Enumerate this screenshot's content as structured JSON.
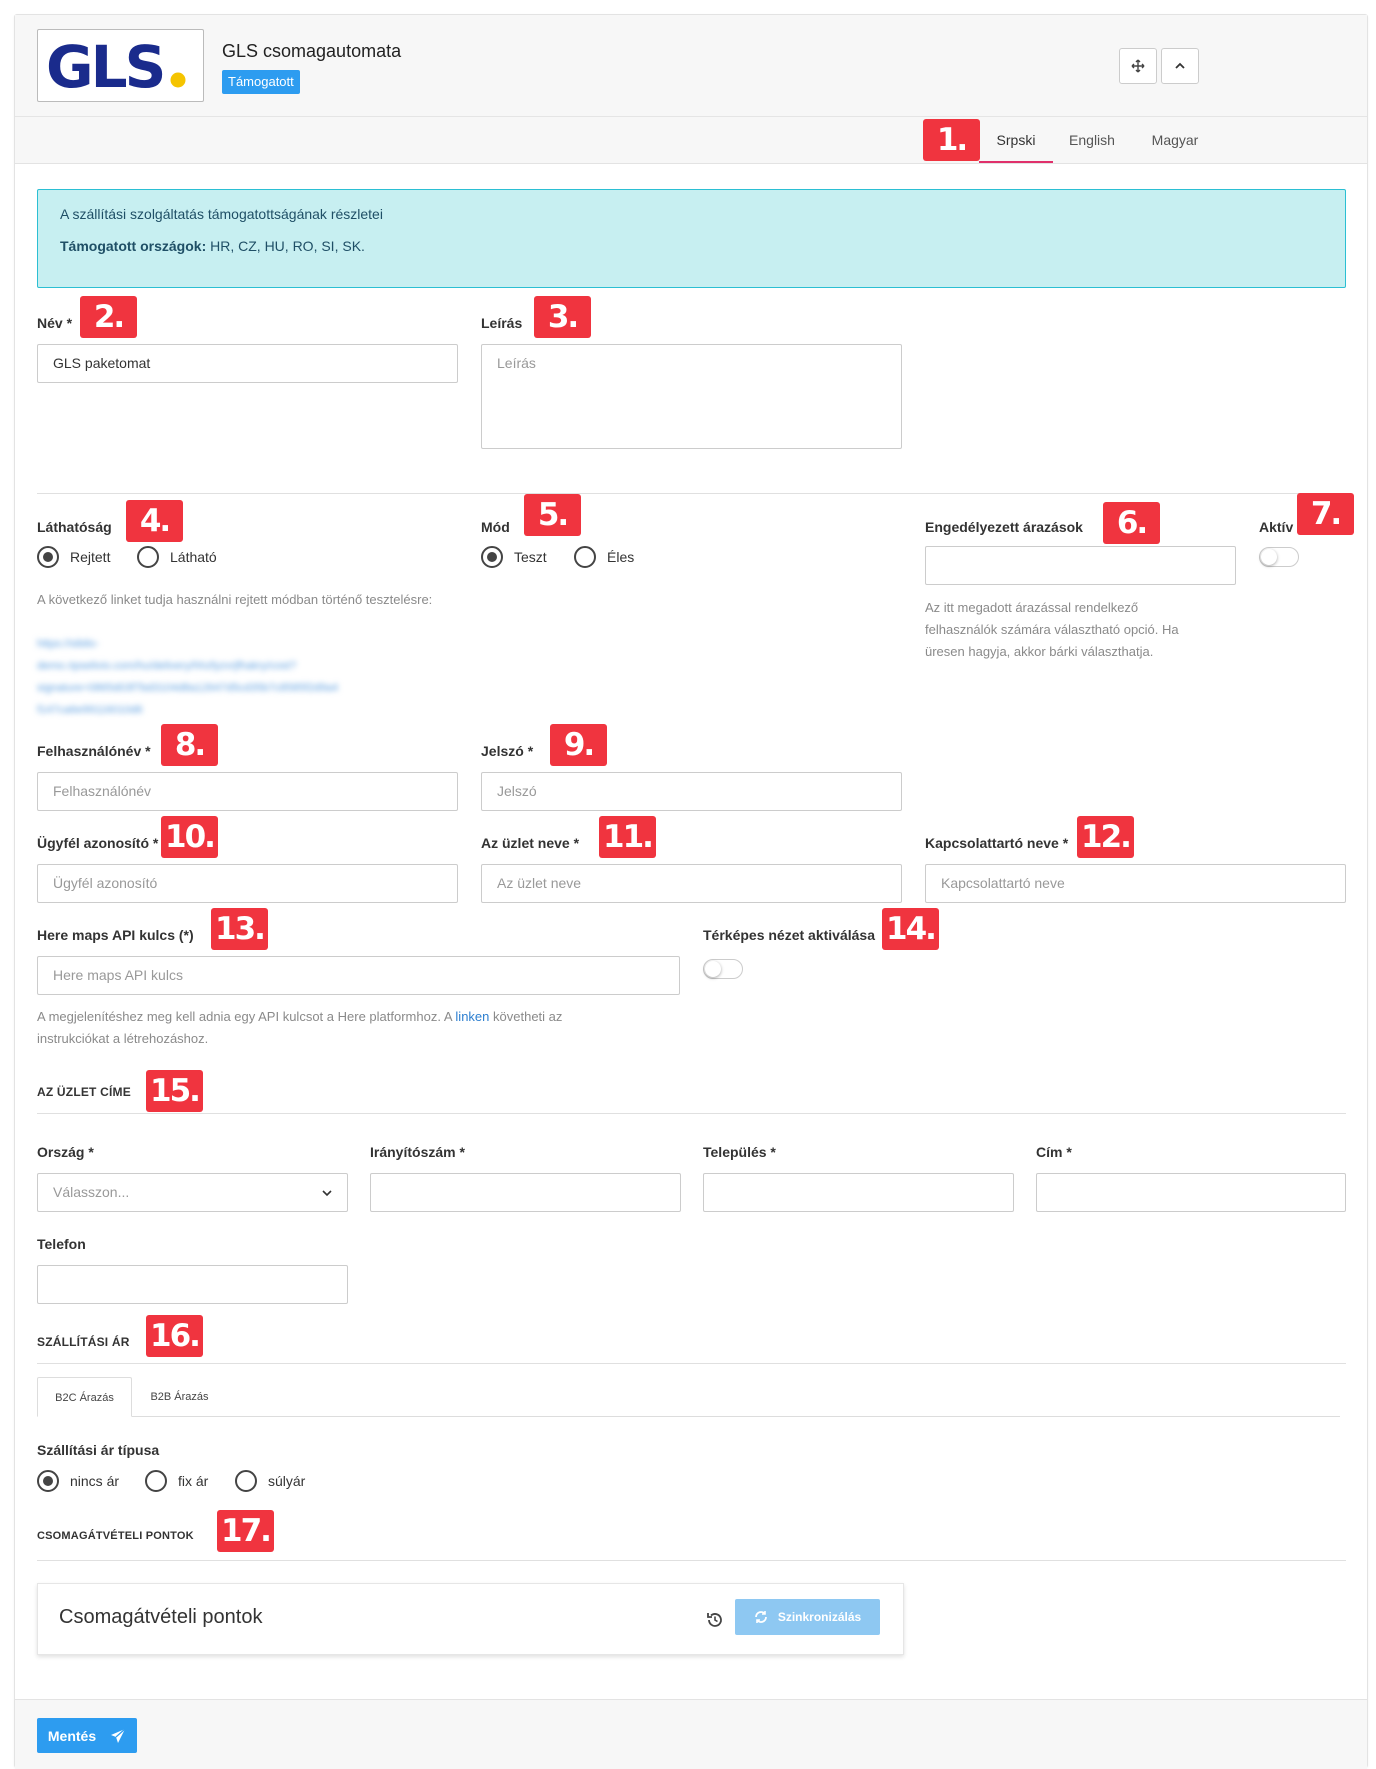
{
  "header": {
    "logo_text": "GLS",
    "title": "GLS csomagautomata",
    "badge": "Támogatott"
  },
  "languages": [
    "Srpski",
    "English",
    "Magyar"
  ],
  "markers": [
    "1.",
    "2.",
    "3.",
    "4.",
    "5.",
    "6.",
    "7.",
    "8.",
    "9.",
    "10.",
    "11.",
    "12.",
    "13.",
    "14.",
    "15.",
    "16.",
    "17."
  ],
  "info": {
    "heading": "A szállítási szolgáltatás támogatottságának részletei",
    "countries_label": "Támogatott országok:",
    "countries": "HR, CZ, HU, RO, SI, SK."
  },
  "name": {
    "label": "Név *",
    "value": "GLS paketomat"
  },
  "description": {
    "label": "Leírás",
    "placeholder": "Leírás"
  },
  "visibility": {
    "label": "Láthatóság",
    "options": [
      "Rejtett",
      "Látható"
    ],
    "selected": "Rejtett",
    "help": "A következő linket tudja használni rejtett módban történő tesztelésre:",
    "link_lines": [
      "https://sibilo-",
      "demo.ripselivio.com/hu/delivery/hhzfyzvrjfhakry/cost?",
      "signature=0865d03f7bd3104d8a12647d5cd35b7c8585f2d9a4",
      "f147ca6e99116010d6"
    ]
  },
  "mode": {
    "label": "Mód",
    "options": [
      "Teszt",
      "Éles"
    ],
    "selected": "Teszt"
  },
  "pricing": {
    "label": "Engedélyezett árazások",
    "help_lines": [
      "Az itt megadott árazással rendelkező",
      "felhasználók számára választható opció. Ha",
      "üresen hagyja, akkor bárki választhatja."
    ]
  },
  "active": {
    "label": "Aktív",
    "on": false
  },
  "username": {
    "label": "Felhasználónév *",
    "placeholder": "Felhasználónév"
  },
  "password": {
    "label": "Jelszó *",
    "placeholder": "Jelszó"
  },
  "client_id": {
    "label": "Ügyfél azonosító *",
    "placeholder": "Ügyfél azonosító"
  },
  "shop_name": {
    "label": "Az üzlet neve *",
    "placeholder": "Az üzlet neve"
  },
  "contact": {
    "label": "Kapcsolattartó neve *",
    "placeholder": "Kapcsolattartó neve"
  },
  "here_api": {
    "label": "Here maps API kulcs (*)",
    "placeholder": "Here maps API kulcs",
    "help_pre": "A megjelenítéshez meg kell adnia egy API kulcsot a Here platformhoz. A",
    "help_link": "linken",
    "help_post": "követheti az",
    "help_line2": "instrukciókat a létrehozáshoz."
  },
  "map_view": {
    "label": "Térképes nézet aktiválása",
    "on": false
  },
  "address": {
    "title": "AZ ÜZLET CÍME",
    "country_label": "Ország *",
    "country_placeholder": "Válasszon...",
    "zip_label": "Irányítószám *",
    "city_label": "Település *",
    "street_label": "Cím *",
    "phone_label": "Telefon"
  },
  "shipping": {
    "title": "SZÁLLÍTÁSI ÁR",
    "tabs": [
      "B2C Árazás",
      "B2B Árazás"
    ],
    "price_type_label": "Szállítási ár típusa",
    "options": [
      "nincs ár",
      "fix ár",
      "súlyár"
    ],
    "selected": "nincs ár"
  },
  "pickup": {
    "title": "CSOMAGÁTVÉTELI PONTOK",
    "panel_title": "Csomagátvételi pontok",
    "sync_label": "Szinkronizálás"
  },
  "save_label": "Mentés",
  "colors": {
    "accent": "#2d9cf0",
    "marker": "#f0343f",
    "info_bg": "#c7eff1",
    "tab_active": "#e0306b"
  }
}
